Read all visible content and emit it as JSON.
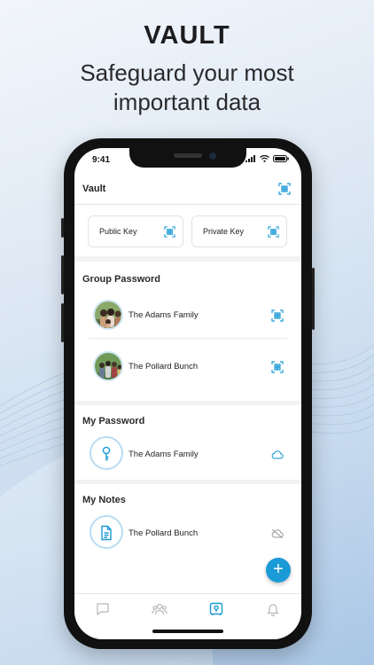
{
  "headline": "VAULT",
  "subline_1": "Safeguard your most",
  "subline_2": "important data",
  "status": {
    "time": "9:41"
  },
  "header": {
    "title": "Vault",
    "scan_icon": "qr-scan-icon"
  },
  "keys": [
    {
      "label": "Public Key",
      "icon": "qr-scan-icon"
    },
    {
      "label": "Private Key",
      "icon": "qr-scan-icon"
    }
  ],
  "group_password": {
    "title": "Group Password",
    "items": [
      {
        "label": "The Adams Family",
        "icon": "qr-scan-icon"
      },
      {
        "label": "The Pollard Bunch",
        "icon": "qr-scan-icon"
      }
    ]
  },
  "my_password": {
    "title": "My Password",
    "items": [
      {
        "label": "The Adams Family",
        "icon": "cloud-icon"
      }
    ]
  },
  "my_notes": {
    "title": "My Notes",
    "items": [
      {
        "label": "The Pollard Bunch",
        "icon": "cloud-off-icon"
      }
    ]
  },
  "fab_label": "+",
  "tabs": [
    "chat-icon",
    "group-icon",
    "vault-icon",
    "bell-icon"
  ],
  "colors": {
    "accent": "#1a9ad6",
    "active_tab": "#1a9ad6",
    "inactive_tab": "#b8b8b8"
  }
}
